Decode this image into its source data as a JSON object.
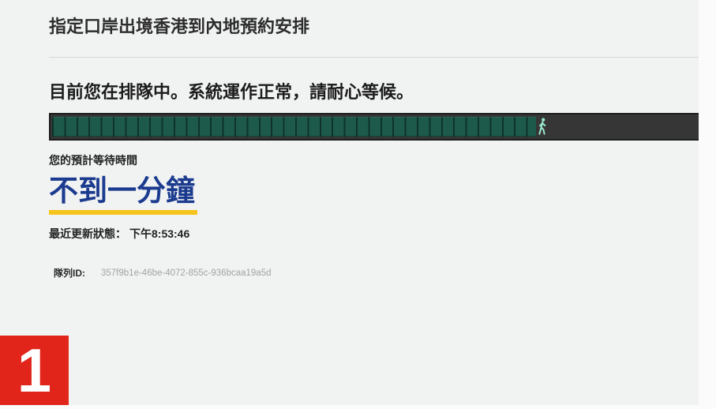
{
  "page": {
    "title": "指定口岸出境香港到內地預約安排"
  },
  "queue": {
    "status_message": "目前您在排隊中。系統運作正常，請耐心等候。",
    "progress_percent": 76,
    "wait_label": "您的預計等待時間",
    "wait_time": "不到一分鐘",
    "last_updated_label": "最近更新狀態：",
    "last_updated_value": "下午8:53:46",
    "queue_id_label": "隊列ID:",
    "queue_id": "357f9b1e-46be-4072-855c-936bcaa19a5d"
  },
  "annotation": {
    "label": "1"
  },
  "icons": {
    "progress_marker": "walking-person-icon"
  },
  "colors": {
    "accent_blue": "#1b3b8f",
    "accent_yellow": "#f6c51d",
    "progress_green": "#1d5a4b",
    "walker_mint": "#9be8cf",
    "badge_red": "#e1251b"
  }
}
